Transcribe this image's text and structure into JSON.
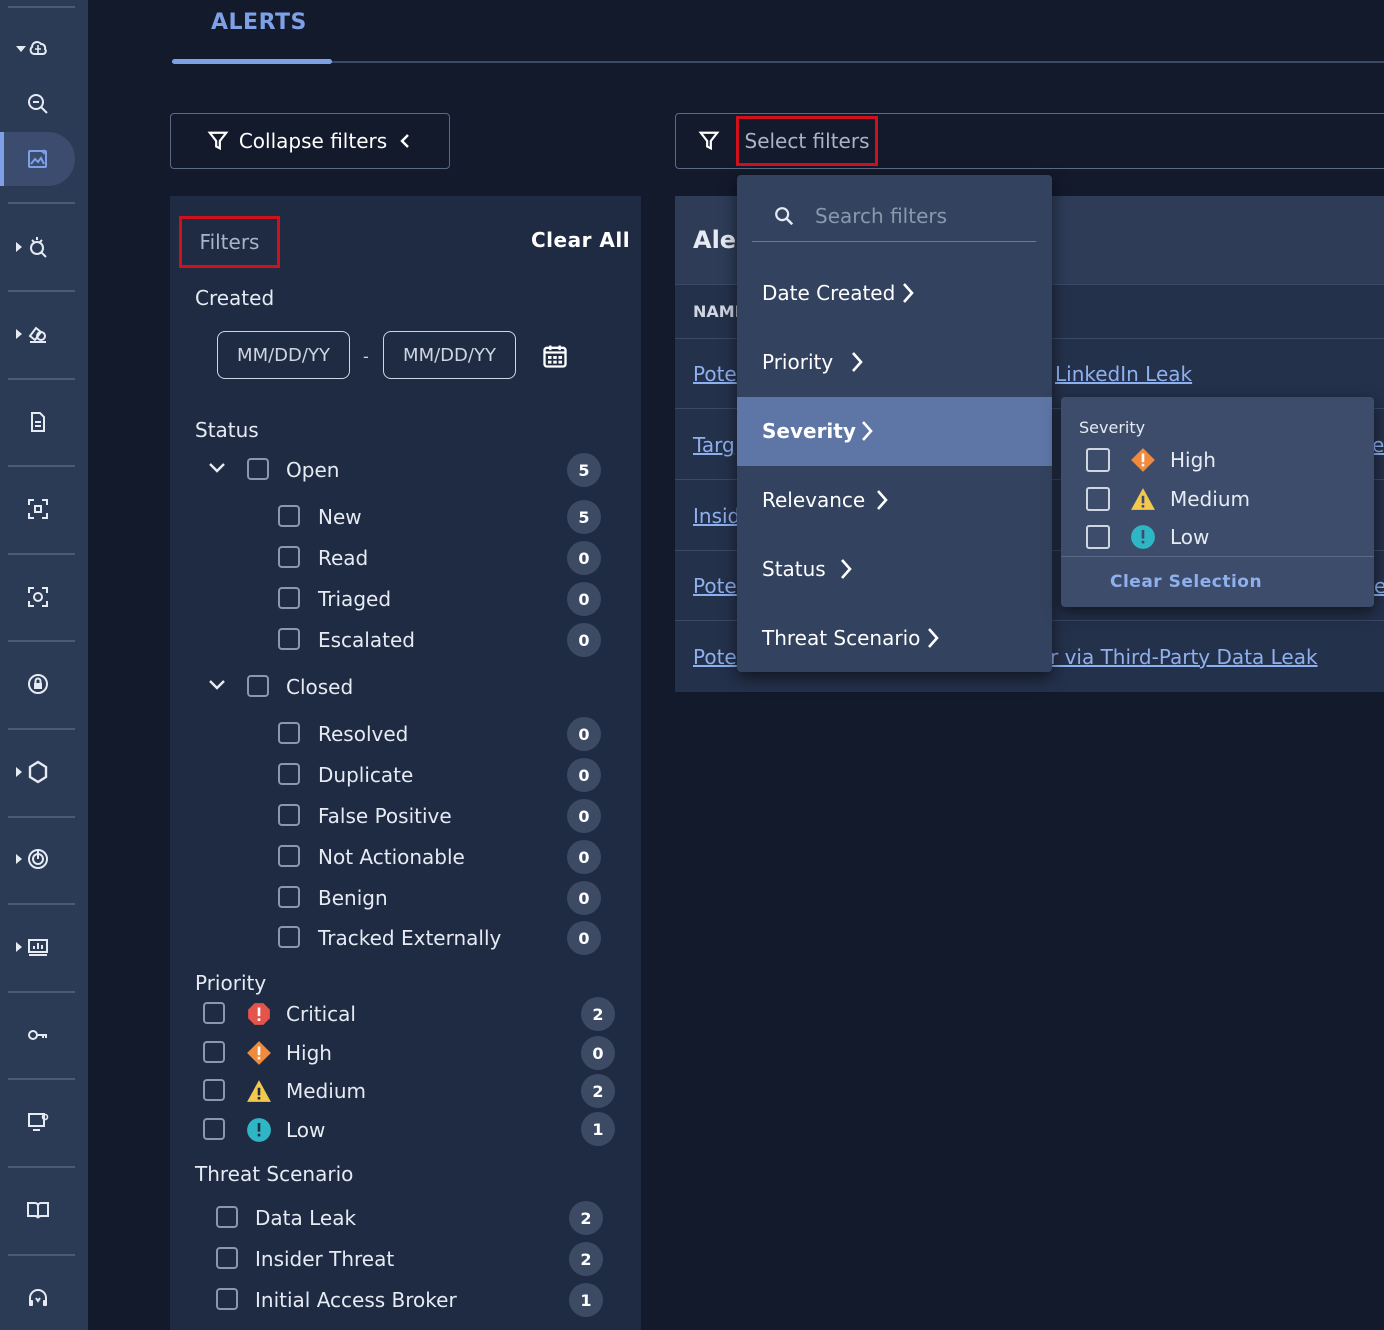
{
  "tabs": [
    {
      "label": "ALERTS",
      "active": true
    }
  ],
  "toolbar": {
    "collapse_label": "Collapse filters",
    "select_filters_label": "Select filters"
  },
  "filters_panel": {
    "title": "Filters",
    "clear_all": "Clear All",
    "created": {
      "label": "Created",
      "from_placeholder": "MM/DD/YY",
      "separator": "-",
      "to_placeholder": "MM/DD/YY"
    },
    "status": {
      "label": "Status",
      "groups": [
        {
          "label": "Open",
          "count": "5",
          "items": [
            {
              "label": "New",
              "count": "5"
            },
            {
              "label": "Read",
              "count": "0"
            },
            {
              "label": "Triaged",
              "count": "0"
            },
            {
              "label": "Escalated",
              "count": "0"
            }
          ]
        },
        {
          "label": "Closed",
          "items": [
            {
              "label": "Resolved",
              "count": "0"
            },
            {
              "label": "Duplicate",
              "count": "0"
            },
            {
              "label": "False Positive",
              "count": "0"
            },
            {
              "label": "Not Actionable",
              "count": "0"
            },
            {
              "label": "Benign",
              "count": "0"
            },
            {
              "label": "Tracked Externally",
              "count": "0"
            }
          ]
        }
      ]
    },
    "priority": {
      "label": "Priority",
      "items": [
        {
          "label": "Critical",
          "count": "2",
          "icon": "critical-icon",
          "color": "#e5534b"
        },
        {
          "label": "High",
          "count": "0",
          "icon": "high-icon",
          "color": "#f08a3c"
        },
        {
          "label": "Medium",
          "count": "2",
          "icon": "medium-icon",
          "color": "#f2c94c"
        },
        {
          "label": "Low",
          "count": "1",
          "icon": "low-icon",
          "color": "#2fb6c4"
        }
      ]
    },
    "threat_scenario": {
      "label": "Threat Scenario",
      "items": [
        {
          "label": "Data Leak",
          "count": "2"
        },
        {
          "label": "Insider Threat",
          "count": "2"
        },
        {
          "label": "Initial Access Broker",
          "count": "1"
        }
      ]
    }
  },
  "table": {
    "title": "Aler",
    "column_name": "NAME",
    "rows": [
      {
        "left": "Pote",
        "right": "LinkedIn Leak"
      },
      {
        "left": "Targ",
        "right": "e"
      },
      {
        "left": "Insid",
        "right": ""
      },
      {
        "left": "Pote",
        "right": "e"
      },
      {
        "left": "Pote",
        "right": "r via Third-Party Data Leak"
      }
    ]
  },
  "filter_menu": {
    "search_placeholder": "Search filters",
    "items": [
      "Date Created",
      "Priority",
      "Severity",
      "Relevance",
      "Status",
      "Threat Scenario"
    ],
    "highlighted": "Severity"
  },
  "severity_submenu": {
    "title": "Severity",
    "options": [
      {
        "label": "High",
        "icon": "high-icon"
      },
      {
        "label": "Medium",
        "icon": "medium-icon"
      },
      {
        "label": "Low",
        "icon": "low-icon"
      }
    ],
    "clear_label": "Clear Selection"
  },
  "colors": {
    "accent": "#7ea0e6",
    "highlight_border": "#d0111b",
    "sidebar": "#2b3a55",
    "background": "#131a2b"
  }
}
